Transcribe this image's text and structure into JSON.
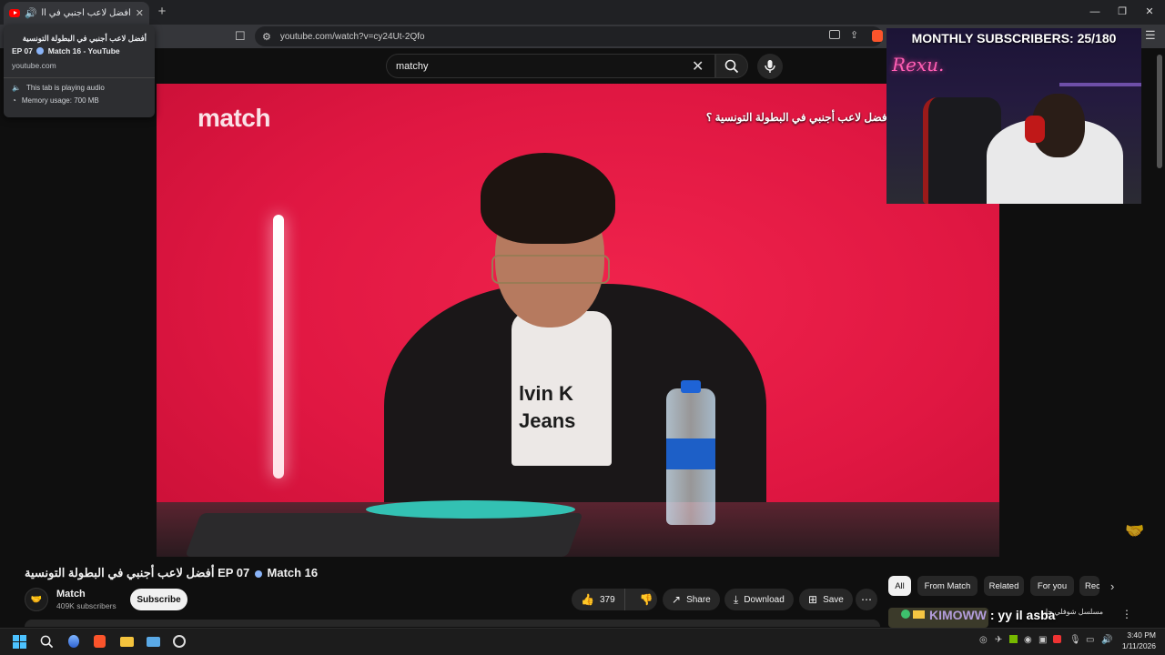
{
  "browser": {
    "tab_title": "أفضل لاعب أجنبي في البطولة",
    "new_tab": "+",
    "url": "youtube.com/watch?v=cy24Ut-2Qfo"
  },
  "hovercard": {
    "title_line1": "أفضل لاعب أجنبي في البطولة التونسية",
    "title_line2_prefix": "EP 07",
    "title_line2_suffix": "Match 16 - YouTube",
    "site": "youtube.com",
    "audio": "This tab is playing audio",
    "memory": "Memory usage: 700 MB"
  },
  "search": {
    "value": "matchy"
  },
  "video": {
    "logo": "match",
    "caption": "أفضل لاعب أجنبي في البطولة التونسية ؟",
    "shirt_text_1": "lvin K",
    "shirt_text_2": "Jeans"
  },
  "webcam": {
    "header": "MONTHLY SUBSCRIBERS: 25/180",
    "neon": "Rexu."
  },
  "info": {
    "title_arabic": "أفضل لاعب أجنبي في البطولة التونسية",
    "title_ep": "EP 07",
    "title_match": "Match 16",
    "channel_name": "Match",
    "subscribers": "409K subscribers",
    "subscribe": "Subscribe",
    "likes": "379",
    "share": "Share",
    "download": "Download",
    "save": "Save"
  },
  "chips": [
    "All",
    "From Match",
    "Related",
    "For you",
    "Rec"
  ],
  "recommendation": {
    "title": "مسلسل شوفلي حل"
  },
  "chat": {
    "user": "KIMOWW",
    "text": ": yy il asba"
  },
  "taskbar": {
    "time": "3:40 PM",
    "date": "1/11/2026"
  },
  "colors": {
    "video_bg": "#e01742",
    "youtube_red": "#ff0000",
    "chip_active": "#f1f1f1",
    "accent_blue": "#4cc2ff"
  }
}
